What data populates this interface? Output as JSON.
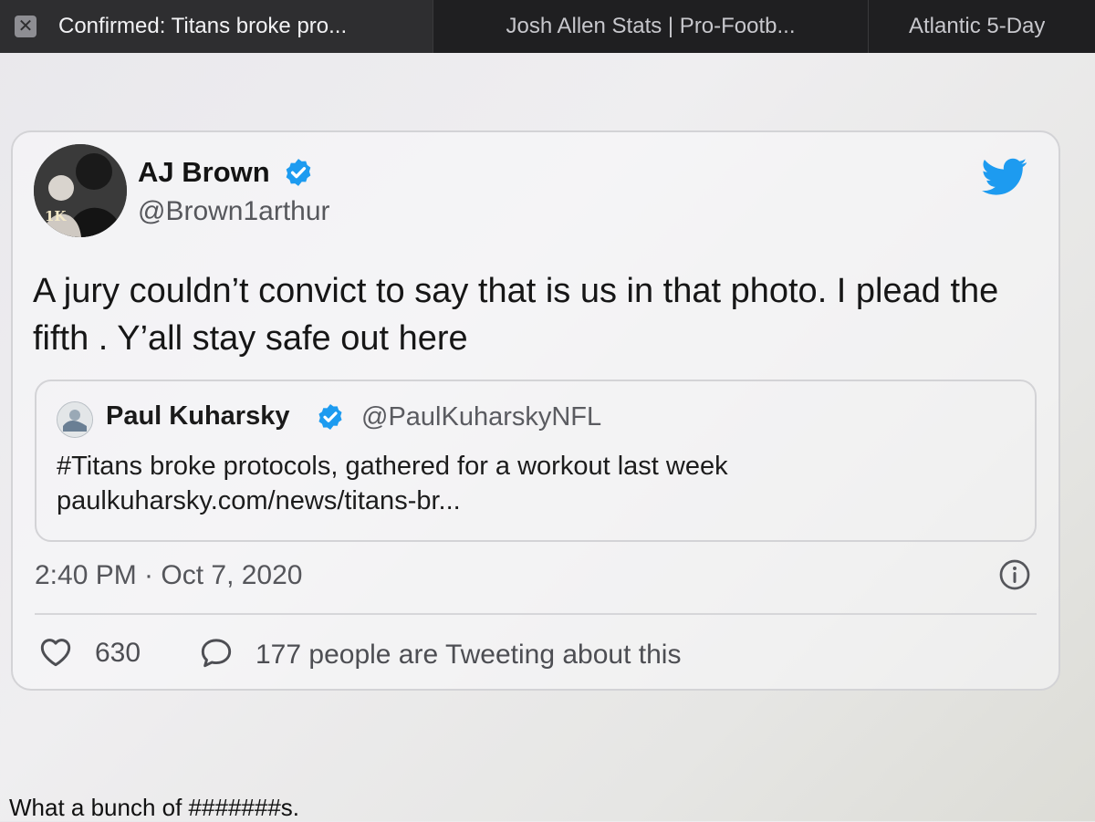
{
  "browser": {
    "tabs": [
      {
        "title": "Confirmed: Titans broke pro...",
        "active": true
      },
      {
        "title": "Josh Allen Stats | Pro-Footb...",
        "active": false
      },
      {
        "title": "Atlantic 5-Day",
        "active": false
      }
    ],
    "close_glyph": "✕"
  },
  "tweet": {
    "author_name": "AJ Brown",
    "author_handle": "@Brown1arthur",
    "avatar_text": "1K",
    "text": "A jury couldn’t convict to say that is us in that photo. I plead the fifth . Y’all stay safe out here",
    "quoted": {
      "author_name": "Paul Kuharsky",
      "author_handle": "@PaulKuharskyNFL",
      "text": "#Titans broke protocols, gathered for a workout last week paulkuharsky.com/news/titans-br..."
    },
    "timestamp": "2:40 PM · Oct 7, 2020",
    "likes": "630",
    "talking_about": "177 people are Tweeting about this",
    "colors": {
      "verified": "#1d9bf0",
      "twitter_bird": "#1d9bf0"
    }
  },
  "caption": "What a bunch of #######s."
}
